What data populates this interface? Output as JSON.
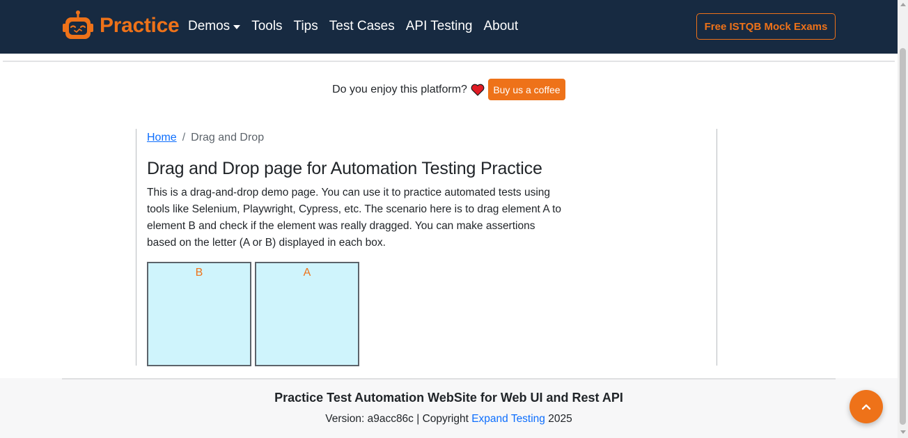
{
  "navbar": {
    "brand_name": "Practice",
    "menu": [
      {
        "label": "Demos"
      },
      {
        "label": "Tools"
      },
      {
        "label": "Tips"
      },
      {
        "label": "Test Cases"
      },
      {
        "label": "API Testing"
      },
      {
        "label": "About"
      }
    ],
    "cta_label": "Free ISTQB Mock Exams"
  },
  "support": {
    "question": "Do you enjoy this platform?",
    "button_label": "Buy us a coffee"
  },
  "breadcrumb": {
    "home": "Home",
    "separator": "/",
    "current": "Drag and Drop"
  },
  "main": {
    "title": "Drag and Drop page for Automation Testing Practice",
    "intro": "This is a drag-and-drop demo page. You can use it to practice automated tests using tools like Selenium, Playwright, Cypress, etc. The scenario here is to drag element A to element B and check if the element was really dragged. You can make assertions based on the letter (A or B) displayed in each box.",
    "boxes": [
      {
        "label": "B"
      },
      {
        "label": "A"
      }
    ]
  },
  "footer": {
    "title": "Practice Test Automation WebSite for Web UI and Rest API",
    "version_prefix": "Version: a9acc86c | Copyright",
    "link_text": "Expand Testing",
    "year": "2025"
  },
  "colors": {
    "navbar_bg": "#172a41",
    "accent": "#ee7219",
    "box_bg": "#cff4fc",
    "link": "#0d6efd"
  },
  "icons": {
    "brand": "robot-logo-icon",
    "support": "heart-icon",
    "menu": "caret-down-icon",
    "back_to_top": "chevron-up-icon"
  }
}
